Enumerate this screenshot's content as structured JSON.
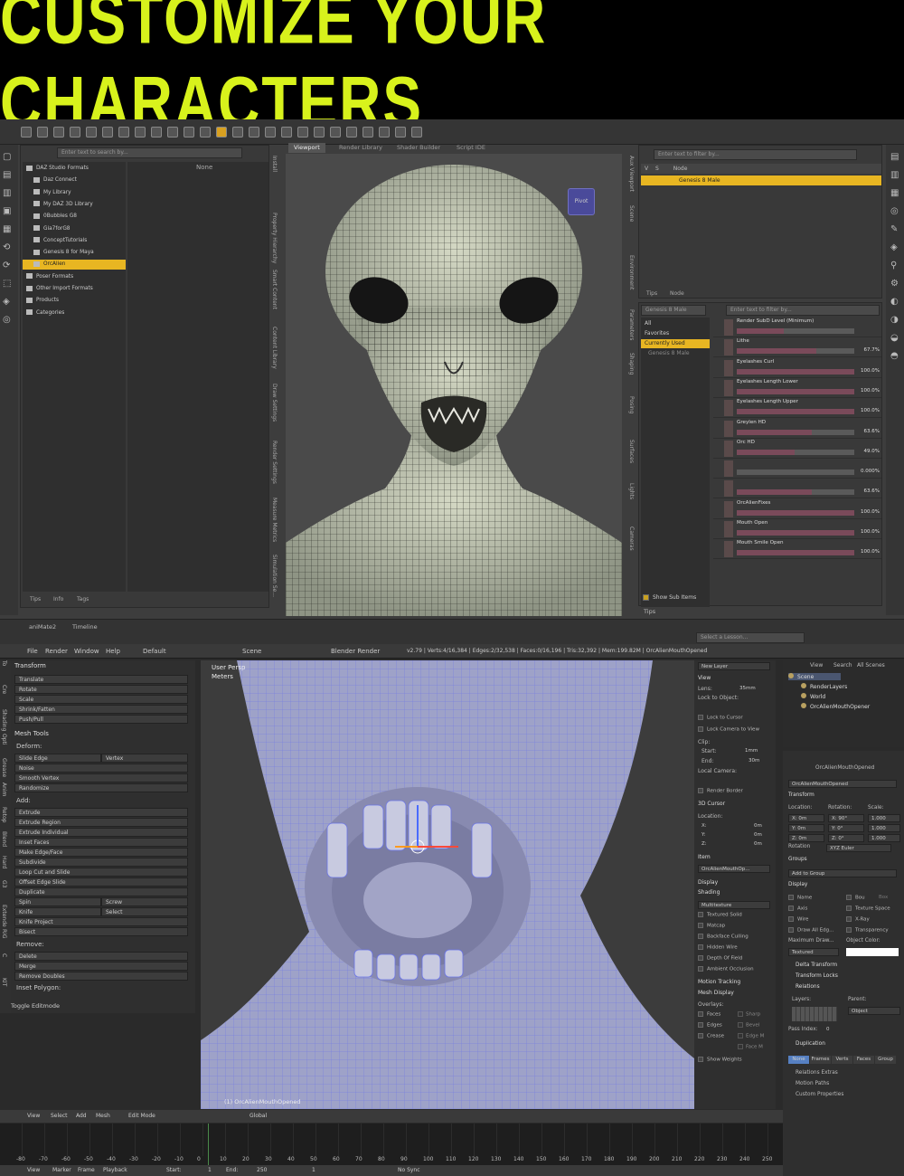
{
  "banner": {
    "title": "CUSTOMIZE YOUR CHARACTERS"
  },
  "daz": {
    "view_tabs": [
      "Viewport",
      "Render Library",
      "Shader Builder",
      "Script IDE"
    ],
    "search_placeholder": "Enter text to search by...",
    "filter_placeholder": "Enter text to filter by...",
    "none_label": "None",
    "tree": [
      "DAZ Studio Formats",
      "Daz Connect",
      "My Library",
      "My DAZ 3D Library",
      "0Bubbles G8",
      "Gia7forG8",
      "ConceptTutorials",
      "Genesis 8 for Maya",
      "OrcAlien",
      "Poser Formats",
      "Other Import Formats",
      "Products",
      "Categories"
    ],
    "left_vtabs": [
      "Install",
      "Property Hierarchy",
      "Smart Content",
      "Content Library",
      "Draw Settings",
      "Render Settings",
      "Measure Metrics",
      "Simulation Se..."
    ],
    "left_bottom_tabs": [
      "Tips",
      "Info",
      "Tags"
    ],
    "bottom_tabs": [
      "aniMate2",
      "Timeline"
    ],
    "pivot_label": "Pivot",
    "scene_cols": [
      "V",
      "S",
      "Node"
    ],
    "scene_node": "Genesis 8 Male",
    "scene_vtabs": [
      "Aux Viewport",
      "Scene",
      "Environment"
    ],
    "scene_tabs": [
      "Tips",
      "Node"
    ],
    "param_vtabs": [
      "Parameters",
      "Shaping",
      "Posing",
      "Surfaces",
      "Lights",
      "Cameras"
    ],
    "param_dropdown": "Genesis 8 Male",
    "param_filter": [
      "All",
      "Favorites",
      "Currently Used"
    ],
    "param_node": "Genesis 8 Male",
    "params": [
      {
        "name": "Render SubD Level (Minimum)",
        "value": "",
        "f": 0.4
      },
      {
        "name": "Lithe",
        "value": "67.7%",
        "f": 0.677
      },
      {
        "name": "Eyelashes Curl",
        "value": "100.0%",
        "f": 1
      },
      {
        "name": "Eyelashes Length Lower",
        "value": "100.0%",
        "f": 1
      },
      {
        "name": "Eyelashes Length Upper",
        "value": "100.0%",
        "f": 1
      },
      {
        "name": "Greylen HD",
        "value": "63.6%",
        "f": 0.636
      },
      {
        "name": "Orc HD",
        "value": "49.0%",
        "f": 0.49
      },
      {
        "name": "",
        "value": "0.000%",
        "f": 0
      },
      {
        "name": "",
        "value": "63.6%",
        "f": 0.636
      },
      {
        "name": "OrcAlienFixes",
        "value": "100.0%",
        "f": 1
      },
      {
        "name": "Mouth Open",
        "value": "100.0%",
        "f": 1
      },
      {
        "name": "Mouth Smile Open",
        "value": "100.0%",
        "f": 1
      }
    ],
    "show_sub_items": "Show Sub Items",
    "right_bottom_tab": "Tips",
    "lesson": "Select a Lesson..."
  },
  "blender": {
    "menu": [
      "File",
      "Render",
      "Window",
      "Help",
      "Default",
      "Scene",
      "Blender Render"
    ],
    "status": "v2.79 | Verts:4/16,384 | Edges:2/32,538 | Faces:0/16,196 | Tris:32,392 | Mem:199.82M | OrcAlienMouthOpened",
    "left_vtabs": [
      "To",
      "Cre",
      "Shading",
      "Opti",
      "Grease",
      "Anim",
      "Retop",
      "Blend",
      "Hard",
      "G3",
      "Extende",
      "RiG",
      "C",
      "KIT"
    ],
    "transform_header": "Transform",
    "transform": [
      "Translate",
      "Rotate",
      "Scale",
      "Shrink/Fatten",
      "Push/Pull"
    ],
    "mesh_tools_header": "Mesh Tools",
    "deform_label": "Deform:",
    "deform": [
      [
        "Slide Edge",
        "Vertex"
      ],
      [
        "Noise",
        ""
      ],
      [
        "Smooth Vertex",
        ""
      ],
      [
        "Randomize",
        ""
      ]
    ],
    "add_label": "Add:",
    "add": [
      [
        "Extrude",
        ""
      ],
      [
        "Extrude Region",
        ""
      ],
      [
        "Extrude Individual",
        ""
      ],
      [
        "Inset Faces",
        ""
      ],
      [
        "Make Edge/Face",
        ""
      ],
      [
        "Subdivide",
        ""
      ],
      [
        "Loop Cut and Slide",
        ""
      ],
      [
        "Offset Edge Slide",
        ""
      ],
      [
        "Duplicate",
        ""
      ],
      [
        "Spin",
        "Screw"
      ],
      [
        "Knife",
        "Select"
      ],
      [
        "Knife Project",
        ""
      ],
      [
        "Bisect",
        ""
      ]
    ],
    "remove_label": "Remove:",
    "remove": [
      "Delete",
      "Merge",
      "Remove Doubles"
    ],
    "inset_label": "Inset Polygon:",
    "toggle_editmode": "Toggle Editmode",
    "viewport_label1": "User Persp",
    "viewport_label2": "Meters",
    "viewport_obj": "(1) OrcAlienMouthOpened",
    "n_panel": {
      "new_layer": "New Layer",
      "view": "View",
      "lens_label": "Lens:",
      "lens_value": "35mm",
      "lock_obj": "Lock to Object:",
      "lock_cursor": "Lock to Cursor",
      "lock_cam": "Lock Camera to View",
      "clip": "Clip:",
      "start_label": "Start:",
      "start_value": "1mm",
      "end_label": "End:",
      "end_value": "30m",
      "local_cam": "Local Camera:",
      "render_border": "Render Border",
      "cursor": "3D Cursor",
      "location": "Location:",
      "xyz": [
        [
          "X:",
          "0m"
        ],
        [
          "Y:",
          "0m"
        ],
        [
          "Z:",
          "0m"
        ]
      ],
      "item": "Item",
      "item_name": "OrcAlienMouthOp...",
      "display": "Display",
      "shading": "Shading",
      "multitexture": "Multitexture",
      "shading_opts": [
        "Textured Solid",
        "Matcap",
        "Backface Culling",
        "Hidden Wire",
        "Depth Of Field",
        "Ambient Occlusion"
      ],
      "motion": "Motion Tracking",
      "mesh_display": "Mesh Display",
      "overlays": "Overlays:",
      "ov_left": [
        "Faces",
        "Edges",
        "Crease"
      ],
      "ov_right": [
        "Sharp",
        "Bevel",
        "Edge M",
        "Face M"
      ],
      "show_weights": "Show Weights"
    },
    "outliner": {
      "tabs": [
        "View",
        "Search",
        "All Scenes"
      ],
      "items": [
        "Scene",
        "RenderLayers",
        "World",
        "OrcAlienMouthOpener"
      ]
    },
    "props": {
      "obj": "OrcAlienMouthOpened",
      "obj2": "OrcAlienMouthOpened",
      "transform": "Transform",
      "loc": "Location:",
      "rot": "Rotation:",
      "scale": "Scale:",
      "rows": [
        [
          "X: 0m",
          "X: 90°",
          "1.000"
        ],
        [
          "Y: 0m",
          "Y: 0°",
          "1.000"
        ],
        [
          "Z: 0m",
          "Z: 0°",
          "1.000"
        ]
      ],
      "rot_mode_label": "Rotation",
      "rot_mode": "XYZ Euler",
      "groups": "Groups",
      "add_group": "Add to Group",
      "display": "Display",
      "disp_left": [
        "Name",
        "Axis",
        "Wire",
        "Draw All Edg..."
      ],
      "disp_right": [
        "Bou",
        "Texture Space",
        "X-Ray",
        "Transparency"
      ],
      "box": "Box",
      "max_draw": "Maximum Draw...",
      "obj_color": "Object Color:",
      "textured": "Textured",
      "delta": "Delta Transform",
      "locks": "Transform Locks",
      "relations": "Relations",
      "layers": "Layers:",
      "parent": "Parent:",
      "object": "Object",
      "pass_index": "Pass Index:",
      "pass_value": "0",
      "duplication": "Duplication",
      "dup_tabs": [
        "None",
        "Frames",
        "Verts",
        "Faces",
        "Group"
      ],
      "rel_extras": "Relations Extras",
      "motion_paths": "Motion Paths",
      "custom_props": "Custom Properties"
    },
    "header": [
      "View",
      "Select",
      "Add",
      "Mesh",
      "Edit Mode",
      "Global"
    ],
    "timeline_ticks": [
      "-80",
      "-70",
      "-60",
      "-50",
      "-40",
      "-30",
      "-20",
      "-10",
      "0",
      "10",
      "20",
      "30",
      "40",
      "50",
      "60",
      "70",
      "80",
      "90",
      "100",
      "110",
      "120",
      "130",
      "140",
      "150",
      "160",
      "170",
      "180",
      "190",
      "200",
      "210",
      "220",
      "230",
      "240",
      "250"
    ],
    "footer": {
      "items": [
        "View",
        "Marker",
        "Frame",
        "Playback"
      ],
      "start_label": "Start:",
      "start": "1",
      "end_label": "End:",
      "end": "250",
      "current": "1",
      "sync": "No Sync"
    }
  }
}
